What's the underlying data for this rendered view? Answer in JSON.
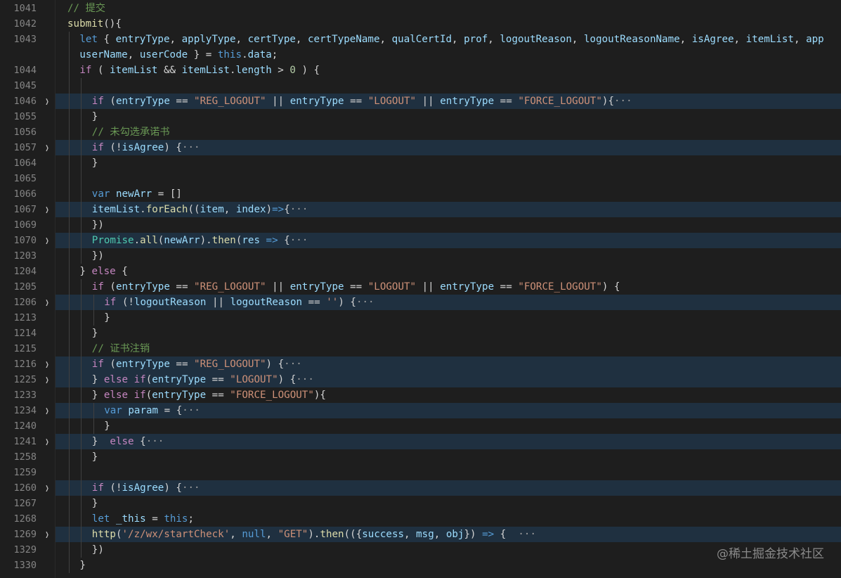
{
  "editor": {
    "watermark": "@稀土掘金技术社区",
    "lines": [
      {
        "ln": "1041",
        "fold": false,
        "hl": false,
        "indent": 1,
        "code": [
          {
            "t": "// 提交",
            "c": "cmt"
          }
        ]
      },
      {
        "ln": "1042",
        "fold": false,
        "hl": false,
        "indent": 1,
        "code": [
          {
            "t": "submit",
            "c": "fn"
          },
          {
            "t": "(){",
            "c": "op"
          }
        ]
      },
      {
        "ln": "1043",
        "fold": false,
        "hl": false,
        "indent": 2,
        "code": [
          {
            "t": "let",
            "c": "kw"
          },
          {
            "t": " { ",
            "c": "op"
          },
          {
            "t": "entryType",
            "c": "var"
          },
          {
            "t": ", ",
            "c": "op"
          },
          {
            "t": "applyType",
            "c": "var"
          },
          {
            "t": ", ",
            "c": "op"
          },
          {
            "t": "certType",
            "c": "var"
          },
          {
            "t": ", ",
            "c": "op"
          },
          {
            "t": "certTypeName",
            "c": "var"
          },
          {
            "t": ", ",
            "c": "op"
          },
          {
            "t": "qualCertId",
            "c": "var"
          },
          {
            "t": ", ",
            "c": "op"
          },
          {
            "t": "prof",
            "c": "var"
          },
          {
            "t": ", ",
            "c": "op"
          },
          {
            "t": "logoutReason",
            "c": "var"
          },
          {
            "t": ", ",
            "c": "op"
          },
          {
            "t": "logoutReasonName",
            "c": "var"
          },
          {
            "t": ", ",
            "c": "op"
          },
          {
            "t": "isAgree",
            "c": "var"
          },
          {
            "t": ", ",
            "c": "op"
          },
          {
            "t": "itemList",
            "c": "var"
          },
          {
            "t": ", ",
            "c": "op"
          },
          {
            "t": "app",
            "c": "var"
          }
        ]
      },
      {
        "ln": "",
        "fold": false,
        "hl": false,
        "indent": 2,
        "code": [
          {
            "t": "userName",
            "c": "var"
          },
          {
            "t": ", ",
            "c": "op"
          },
          {
            "t": "userCode",
            "c": "var"
          },
          {
            "t": " } = ",
            "c": "op"
          },
          {
            "t": "this",
            "c": "kw"
          },
          {
            "t": ".",
            "c": "op"
          },
          {
            "t": "data",
            "c": "var"
          },
          {
            "t": ";",
            "c": "op"
          }
        ]
      },
      {
        "ln": "1044",
        "fold": false,
        "hl": false,
        "indent": 2,
        "code": [
          {
            "t": "if",
            "c": "ctl"
          },
          {
            "t": " ( ",
            "c": "op"
          },
          {
            "t": "itemList",
            "c": "var"
          },
          {
            "t": " && ",
            "c": "op"
          },
          {
            "t": "itemList",
            "c": "var"
          },
          {
            "t": ".",
            "c": "op"
          },
          {
            "t": "length",
            "c": "var"
          },
          {
            "t": " > ",
            "c": "op"
          },
          {
            "t": "0",
            "c": "num"
          },
          {
            "t": " ) {",
            "c": "op"
          }
        ]
      },
      {
        "ln": "1045",
        "fold": false,
        "hl": false,
        "indent": 3,
        "code": []
      },
      {
        "ln": "1046",
        "fold": true,
        "hl": true,
        "indent": 3,
        "code": [
          {
            "t": "if",
            "c": "ctl"
          },
          {
            "t": " (",
            "c": "op"
          },
          {
            "t": "entryType",
            "c": "var"
          },
          {
            "t": " == ",
            "c": "op"
          },
          {
            "t": "\"REG_LOGOUT\"",
            "c": "str"
          },
          {
            "t": " || ",
            "c": "op"
          },
          {
            "t": "entryType",
            "c": "var"
          },
          {
            "t": " == ",
            "c": "op"
          },
          {
            "t": "\"LOGOUT\"",
            "c": "str"
          },
          {
            "t": " || ",
            "c": "op"
          },
          {
            "t": "entryType",
            "c": "var"
          },
          {
            "t": " == ",
            "c": "op"
          },
          {
            "t": "\"FORCE_LOGOUT\"",
            "c": "str"
          },
          {
            "t": "){",
            "c": "op"
          },
          {
            "t": "···",
            "c": "ell"
          }
        ]
      },
      {
        "ln": "1055",
        "fold": false,
        "hl": false,
        "indent": 3,
        "code": [
          {
            "t": "}",
            "c": "op"
          }
        ]
      },
      {
        "ln": "1056",
        "fold": false,
        "hl": false,
        "indent": 3,
        "code": [
          {
            "t": "// 未勾选承诺书",
            "c": "cmt"
          }
        ]
      },
      {
        "ln": "1057",
        "fold": true,
        "hl": true,
        "indent": 3,
        "code": [
          {
            "t": "if",
            "c": "ctl"
          },
          {
            "t": " (!",
            "c": "op"
          },
          {
            "t": "isAgree",
            "c": "var"
          },
          {
            "t": ") {",
            "c": "op"
          },
          {
            "t": "···",
            "c": "ell"
          }
        ]
      },
      {
        "ln": "1064",
        "fold": false,
        "hl": false,
        "indent": 3,
        "code": [
          {
            "t": "}",
            "c": "op"
          }
        ]
      },
      {
        "ln": "1065",
        "fold": false,
        "hl": false,
        "indent": 3,
        "code": []
      },
      {
        "ln": "1066",
        "fold": false,
        "hl": false,
        "indent": 3,
        "code": [
          {
            "t": "var",
            "c": "kw"
          },
          {
            "t": " ",
            "c": "op"
          },
          {
            "t": "newArr",
            "c": "var"
          },
          {
            "t": " = []",
            "c": "op"
          }
        ]
      },
      {
        "ln": "1067",
        "fold": true,
        "hl": true,
        "indent": 3,
        "code": [
          {
            "t": "itemList",
            "c": "var"
          },
          {
            "t": ".",
            "c": "op"
          },
          {
            "t": "forEach",
            "c": "fn"
          },
          {
            "t": "((",
            "c": "op"
          },
          {
            "t": "item",
            "c": "var"
          },
          {
            "t": ", ",
            "c": "op"
          },
          {
            "t": "index",
            "c": "var"
          },
          {
            "t": ")",
            "c": "op"
          },
          {
            "t": "=>",
            "c": "kw"
          },
          {
            "t": "{",
            "c": "op"
          },
          {
            "t": "···",
            "c": "ell"
          }
        ]
      },
      {
        "ln": "1069",
        "fold": false,
        "hl": false,
        "indent": 3,
        "code": [
          {
            "t": "})",
            "c": "op"
          }
        ]
      },
      {
        "ln": "1070",
        "fold": true,
        "hl": true,
        "indent": 3,
        "code": [
          {
            "t": "Promise",
            "c": "cls"
          },
          {
            "t": ".",
            "c": "op"
          },
          {
            "t": "all",
            "c": "fn"
          },
          {
            "t": "(",
            "c": "op"
          },
          {
            "t": "newArr",
            "c": "var"
          },
          {
            "t": ").",
            "c": "op"
          },
          {
            "t": "then",
            "c": "fn"
          },
          {
            "t": "(",
            "c": "op"
          },
          {
            "t": "res",
            "c": "var"
          },
          {
            "t": " ",
            "c": "op"
          },
          {
            "t": "=>",
            "c": "kw"
          },
          {
            "t": " {",
            "c": "op"
          },
          {
            "t": "···",
            "c": "ell"
          }
        ]
      },
      {
        "ln": "1203",
        "fold": false,
        "hl": false,
        "indent": 3,
        "code": [
          {
            "t": "})",
            "c": "op"
          }
        ]
      },
      {
        "ln": "1204",
        "fold": false,
        "hl": false,
        "indent": 2,
        "code": [
          {
            "t": "} ",
            "c": "op"
          },
          {
            "t": "else",
            "c": "ctl"
          },
          {
            "t": " {",
            "c": "op"
          }
        ]
      },
      {
        "ln": "1205",
        "fold": false,
        "hl": false,
        "indent": 3,
        "code": [
          {
            "t": "if",
            "c": "ctl"
          },
          {
            "t": " (",
            "c": "op"
          },
          {
            "t": "entryType",
            "c": "var"
          },
          {
            "t": " == ",
            "c": "op"
          },
          {
            "t": "\"REG_LOGOUT\"",
            "c": "str"
          },
          {
            "t": " || ",
            "c": "op"
          },
          {
            "t": "entryType",
            "c": "var"
          },
          {
            "t": " == ",
            "c": "op"
          },
          {
            "t": "\"LOGOUT\"",
            "c": "str"
          },
          {
            "t": " || ",
            "c": "op"
          },
          {
            "t": "entryType",
            "c": "var"
          },
          {
            "t": " == ",
            "c": "op"
          },
          {
            "t": "\"FORCE_LOGOUT\"",
            "c": "str"
          },
          {
            "t": ") {",
            "c": "op"
          }
        ]
      },
      {
        "ln": "1206",
        "fold": true,
        "hl": true,
        "indent": 4,
        "code": [
          {
            "t": "if",
            "c": "ctl"
          },
          {
            "t": " (!",
            "c": "op"
          },
          {
            "t": "logoutReason",
            "c": "var"
          },
          {
            "t": " || ",
            "c": "op"
          },
          {
            "t": "logoutReason",
            "c": "var"
          },
          {
            "t": " == ",
            "c": "op"
          },
          {
            "t": "''",
            "c": "str"
          },
          {
            "t": ") {",
            "c": "op"
          },
          {
            "t": "···",
            "c": "ell"
          }
        ]
      },
      {
        "ln": "1213",
        "fold": false,
        "hl": false,
        "indent": 4,
        "code": [
          {
            "t": "}",
            "c": "op"
          }
        ]
      },
      {
        "ln": "1214",
        "fold": false,
        "hl": false,
        "indent": 3,
        "code": [
          {
            "t": "}",
            "c": "op"
          }
        ]
      },
      {
        "ln": "1215",
        "fold": false,
        "hl": false,
        "indent": 3,
        "code": [
          {
            "t": "// 证书注销",
            "c": "cmt"
          }
        ]
      },
      {
        "ln": "1216",
        "fold": true,
        "hl": true,
        "indent": 3,
        "code": [
          {
            "t": "if",
            "c": "ctl"
          },
          {
            "t": " (",
            "c": "op"
          },
          {
            "t": "entryType",
            "c": "var"
          },
          {
            "t": " == ",
            "c": "op"
          },
          {
            "t": "\"REG_LOGOUT\"",
            "c": "str"
          },
          {
            "t": ") {",
            "c": "op"
          },
          {
            "t": "···",
            "c": "ell"
          }
        ]
      },
      {
        "ln": "1225",
        "fold": true,
        "hl": true,
        "indent": 3,
        "code": [
          {
            "t": "} ",
            "c": "op"
          },
          {
            "t": "else",
            "c": "ctl"
          },
          {
            "t": " ",
            "c": "op"
          },
          {
            "t": "if",
            "c": "ctl"
          },
          {
            "t": "(",
            "c": "op"
          },
          {
            "t": "entryType",
            "c": "var"
          },
          {
            "t": " == ",
            "c": "op"
          },
          {
            "t": "\"LOGOUT\"",
            "c": "str"
          },
          {
            "t": ") {",
            "c": "op"
          },
          {
            "t": "···",
            "c": "ell"
          }
        ]
      },
      {
        "ln": "1233",
        "fold": false,
        "hl": false,
        "indent": 3,
        "code": [
          {
            "t": "} ",
            "c": "op"
          },
          {
            "t": "else",
            "c": "ctl"
          },
          {
            "t": " ",
            "c": "op"
          },
          {
            "t": "if",
            "c": "ctl"
          },
          {
            "t": "(",
            "c": "op"
          },
          {
            "t": "entryType",
            "c": "var"
          },
          {
            "t": " == ",
            "c": "op"
          },
          {
            "t": "\"FORCE_LOGOUT\"",
            "c": "str"
          },
          {
            "t": "){",
            "c": "op"
          }
        ]
      },
      {
        "ln": "1234",
        "fold": true,
        "hl": true,
        "indent": 4,
        "code": [
          {
            "t": "var",
            "c": "kw"
          },
          {
            "t": " ",
            "c": "op"
          },
          {
            "t": "param",
            "c": "var"
          },
          {
            "t": " = {",
            "c": "op"
          },
          {
            "t": "···",
            "c": "ell"
          }
        ]
      },
      {
        "ln": "1240",
        "fold": false,
        "hl": false,
        "indent": 4,
        "code": [
          {
            "t": "}",
            "c": "op"
          }
        ]
      },
      {
        "ln": "1241",
        "fold": true,
        "hl": true,
        "indent": 3,
        "code": [
          {
            "t": "}  ",
            "c": "op"
          },
          {
            "t": "else",
            "c": "ctl"
          },
          {
            "t": " {",
            "c": "op"
          },
          {
            "t": "···",
            "c": "ell"
          }
        ]
      },
      {
        "ln": "1258",
        "fold": false,
        "hl": false,
        "indent": 3,
        "code": [
          {
            "t": "}",
            "c": "op"
          }
        ]
      },
      {
        "ln": "1259",
        "fold": false,
        "hl": false,
        "indent": 3,
        "code": []
      },
      {
        "ln": "1260",
        "fold": true,
        "hl": true,
        "indent": 3,
        "code": [
          {
            "t": "if",
            "c": "ctl"
          },
          {
            "t": " (!",
            "c": "op"
          },
          {
            "t": "isAgree",
            "c": "var"
          },
          {
            "t": ") {",
            "c": "op"
          },
          {
            "t": "···",
            "c": "ell"
          }
        ]
      },
      {
        "ln": "1267",
        "fold": false,
        "hl": false,
        "indent": 3,
        "code": [
          {
            "t": "}",
            "c": "op"
          }
        ]
      },
      {
        "ln": "1268",
        "fold": false,
        "hl": false,
        "indent": 3,
        "code": [
          {
            "t": "let",
            "c": "kw"
          },
          {
            "t": " ",
            "c": "op"
          },
          {
            "t": "_this",
            "c": "var"
          },
          {
            "t": " = ",
            "c": "op"
          },
          {
            "t": "this",
            "c": "kw"
          },
          {
            "t": ";",
            "c": "op"
          }
        ]
      },
      {
        "ln": "1269",
        "fold": true,
        "hl": true,
        "indent": 3,
        "code": [
          {
            "t": "http",
            "c": "fn"
          },
          {
            "t": "(",
            "c": "op"
          },
          {
            "t": "'/z/wx/startCheck'",
            "c": "str"
          },
          {
            "t": ", ",
            "c": "op"
          },
          {
            "t": "null",
            "c": "kw"
          },
          {
            "t": ", ",
            "c": "op"
          },
          {
            "t": "\"GET\"",
            "c": "str"
          },
          {
            "t": ").",
            "c": "op"
          },
          {
            "t": "then",
            "c": "fn"
          },
          {
            "t": "(({",
            "c": "op"
          },
          {
            "t": "success",
            "c": "var"
          },
          {
            "t": ", ",
            "c": "op"
          },
          {
            "t": "msg",
            "c": "var"
          },
          {
            "t": ", ",
            "c": "op"
          },
          {
            "t": "obj",
            "c": "var"
          },
          {
            "t": "}) ",
            "c": "op"
          },
          {
            "t": "=>",
            "c": "kw"
          },
          {
            "t": " {  ",
            "c": "op"
          },
          {
            "t": "···",
            "c": "ell"
          }
        ]
      },
      {
        "ln": "1329",
        "fold": false,
        "hl": false,
        "indent": 3,
        "code": [
          {
            "t": "})",
            "c": "op"
          }
        ]
      },
      {
        "ln": "1330",
        "fold": false,
        "hl": false,
        "indent": 2,
        "code": [
          {
            "t": "}",
            "c": "op"
          }
        ]
      }
    ]
  }
}
